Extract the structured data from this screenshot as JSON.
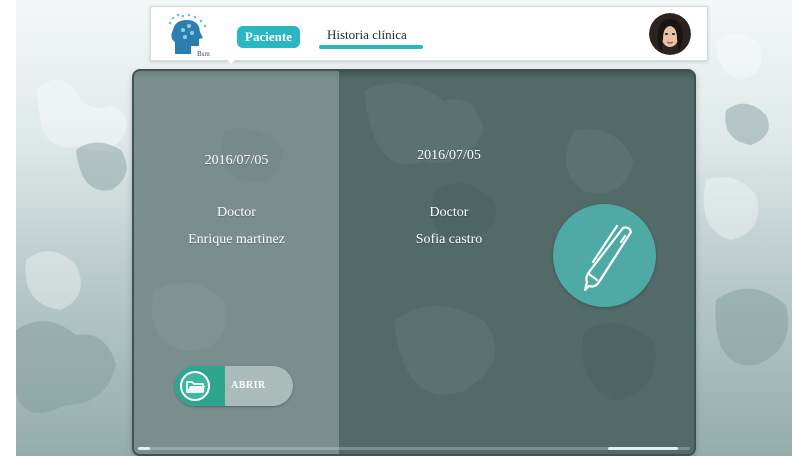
{
  "header": {
    "logo_text": "Bsm",
    "tabs": [
      {
        "label": "Paciente",
        "active": true
      },
      {
        "label": "Historia clínica",
        "active": false
      }
    ],
    "avatar_icon": "user-avatar-photo"
  },
  "records": [
    {
      "date": "2016/07/05",
      "role": "Doctor",
      "doctor": "Enrique martinez"
    },
    {
      "date": "2016/07/05",
      "role": "Doctor",
      "doctor": "Sofia castro"
    }
  ],
  "actions": {
    "open_label": "ABRIR",
    "open_icon": "folder-icon",
    "edit_icon": "pen-icon"
  },
  "colors": {
    "accent": "#2bb7c0",
    "panel": "#58706f",
    "pen_circle": "#4fa9a5",
    "open_button": "#2fa58f"
  }
}
